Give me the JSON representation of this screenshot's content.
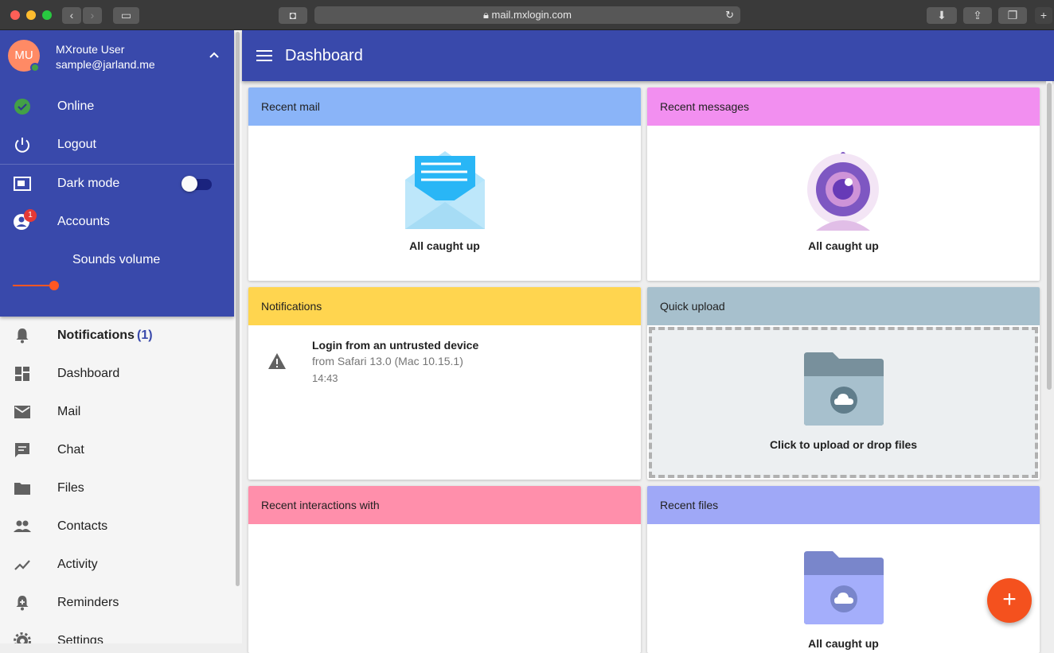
{
  "browser": {
    "url": "mail.mxlogin.com"
  },
  "user": {
    "initials": "MU",
    "name": "MXroute User",
    "email": "sample@jarland.me"
  },
  "account_menu": [
    {
      "label": "Online",
      "icon": "online-status-icon"
    },
    {
      "label": "Logout",
      "icon": "power-icon"
    },
    {
      "label": "Dark mode",
      "icon": "dark-mode-icon",
      "toggle": false
    },
    {
      "label": "Accounts",
      "icon": "account-icon",
      "badge": "1"
    }
  ],
  "sounds": {
    "label": "Sounds volume",
    "level": 0.45
  },
  "nav": {
    "notifications_label": "Notifications",
    "notifications_count": "(1)",
    "items": [
      "Dashboard",
      "Mail",
      "Chat",
      "Files",
      "Contacts",
      "Activity",
      "Reminders",
      "Settings"
    ]
  },
  "appbar": {
    "title": "Dashboard"
  },
  "cards": {
    "recent_mail": {
      "title": "Recent mail",
      "color": "#8ab4f8",
      "status": "All caught up"
    },
    "recent_messages": {
      "title": "Recent messages",
      "color": "#f28ff0",
      "status": "All caught up"
    },
    "notifications": {
      "title": "Notifications",
      "color": "#ffd54f",
      "item": {
        "title": "Login from an untrusted device",
        "detail": "from Safari 13.0 (Mac 10.15.1)",
        "time": "14:43"
      }
    },
    "quick_upload": {
      "title": "Quick upload",
      "color": "#a7c0cd",
      "prompt": "Click to upload or drop files"
    },
    "recent_interactions": {
      "title": "Recent interactions with",
      "color": "#ff8fab"
    },
    "recent_files": {
      "title": "Recent files",
      "color": "#9fa8f7",
      "status": "All caught up"
    }
  },
  "fab": {
    "label": "+"
  }
}
